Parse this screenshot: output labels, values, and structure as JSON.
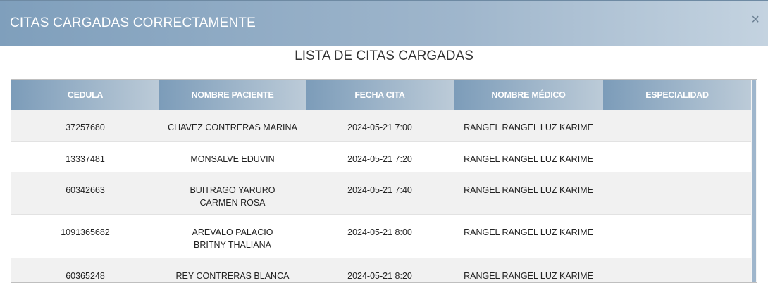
{
  "modal": {
    "title": "CITAS CARGADAS CORRECTAMENTE",
    "close_symbol": "×",
    "list_title": "LISTA DE CITAS CARGADAS"
  },
  "table": {
    "columns": [
      "CEDULA",
      "NOMBRE PACIENTE",
      "FECHA CITA",
      "NOMBRE MÉDICO",
      "ESPECIALIDAD"
    ],
    "rows": [
      {
        "cedula": "37257680",
        "nombre": "CHAVEZ CONTRERAS MARINA",
        "fecha": "2024-05-21 7:00",
        "medico": "RANGEL RANGEL LUZ KARIME",
        "especialidad": ""
      },
      {
        "cedula": "13337481",
        "nombre": "MONSALVE EDUVIN",
        "fecha": "2024-05-21 7:20",
        "medico": "RANGEL RANGEL LUZ KARIME",
        "especialidad": ""
      },
      {
        "cedula": "60342663",
        "nombre": "BUITRAGO YARURO CARMEN ROSA",
        "fecha": "2024-05-21 7:40",
        "medico": "RANGEL RANGEL LUZ KARIME",
        "especialidad": ""
      },
      {
        "cedula": "1091365682",
        "nombre": "AREVALO PALACIO BRITNY THALIANA",
        "fecha": "2024-05-21 8:00",
        "medico": "RANGEL RANGEL LUZ KARIME",
        "especialidad": ""
      },
      {
        "cedula": "60365248",
        "nombre": "REY CONTRERAS BLANCA LUDY",
        "fecha": "2024-05-21 8:20",
        "medico": "RANGEL RANGEL LUZ KARIME",
        "especialidad": ""
      }
    ]
  },
  "colors": {
    "header_gradient_start": "#7f9fbc",
    "header_gradient_end": "#c4d3e0",
    "row_alt": "#f1f1f1"
  }
}
